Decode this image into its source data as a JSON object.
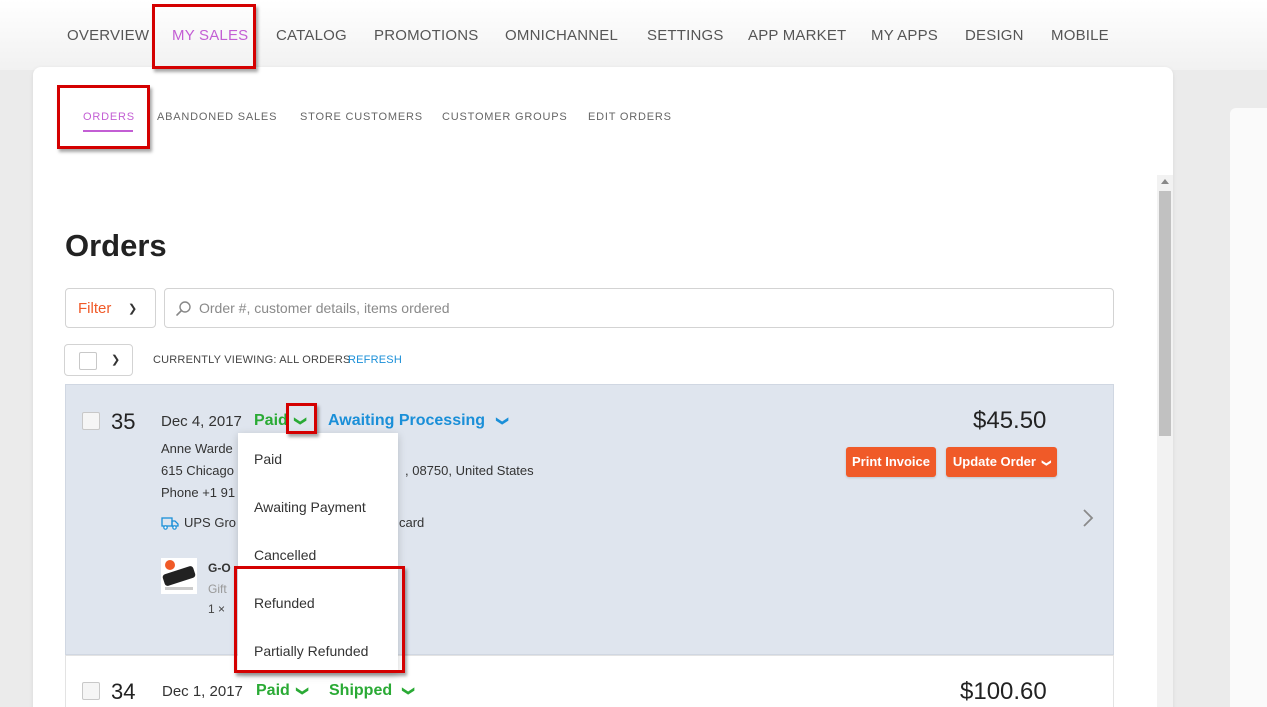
{
  "top_nav": {
    "items": [
      {
        "label": "OVERVIEW"
      },
      {
        "label": "MY SALES",
        "active": true
      },
      {
        "label": "CATALOG"
      },
      {
        "label": "PROMOTIONS"
      },
      {
        "label": "OMNICHANNEL"
      },
      {
        "label": "SETTINGS"
      },
      {
        "label": "APP MARKET"
      },
      {
        "label": "MY APPS"
      },
      {
        "label": "DESIGN"
      },
      {
        "label": "MOBILE"
      }
    ]
  },
  "sub_nav": {
    "items": [
      {
        "label": "ORDERS",
        "active": true
      },
      {
        "label": "ABANDONED SALES"
      },
      {
        "label": "STORE CUSTOMERS"
      },
      {
        "label": "CUSTOMER GROUPS"
      },
      {
        "label": "EDIT ORDERS"
      }
    ]
  },
  "page": {
    "title": "Orders"
  },
  "toolbar": {
    "filter_label": "Filter",
    "search_placeholder": "Order #, customer details, items ordered",
    "viewing_label": "CURRENTLY VIEWING: ALL ORDERS",
    "refresh_label": "REFRESH"
  },
  "orders": [
    {
      "number": "35",
      "date": "Dec 4, 2017",
      "payment_status": "Paid",
      "fulfillment_status": "Awaiting Processing",
      "total": "$45.50",
      "customer_name": "Anne Warde",
      "address": "615 Chicago",
      "address_tail": ", 08750, United States",
      "phone": "Phone +1 91",
      "shipping": "UPS Gro",
      "payment_tail": "card",
      "product_name": "G-O",
      "product_note": "Gift",
      "product_qty": "1 ×",
      "print_invoice_label": "Print Invoice",
      "update_order_label": "Update Order"
    },
    {
      "number": "34",
      "date": "Dec 1, 2017",
      "payment_status": "Paid",
      "fulfillment_status": "Shipped",
      "total": "$100.60"
    }
  ],
  "payment_menu": {
    "options": [
      "Paid",
      "Awaiting Payment",
      "Cancelled",
      "Refunded",
      "Partially Refunded"
    ]
  },
  "colors": {
    "accent_purple": "#c35ed4",
    "orange": "#f05a28",
    "green": "#2aaa35",
    "blue": "#1a8fd8",
    "annotation_red": "#d40000"
  }
}
